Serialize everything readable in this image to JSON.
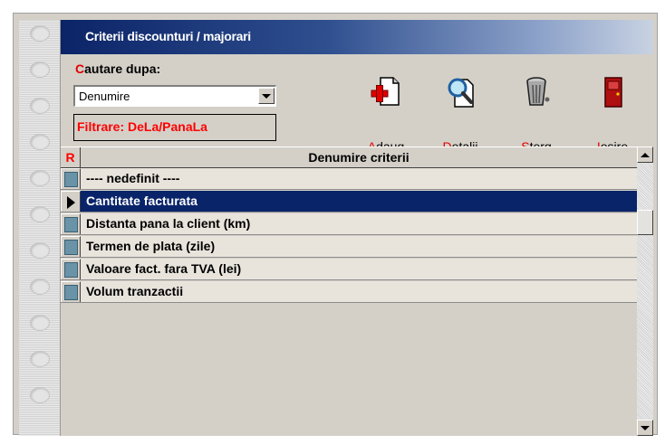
{
  "window": {
    "title": "Criterii discounturi / majorari"
  },
  "search": {
    "label_hotkey": "C",
    "label_rest": "autare dupa:",
    "selected": "Denumire",
    "filter_text": "Filtrare: DeLa/PanaLa"
  },
  "toolbar": [
    {
      "name": "add",
      "hotkey": "A",
      "rest": "daug",
      "icon": "add-document-icon"
    },
    {
      "name": "details",
      "hotkey": "D",
      "rest": "etalii",
      "icon": "magnifier-document-icon"
    },
    {
      "name": "delete",
      "hotkey": "S",
      "rest": "terg",
      "icon": "trash-can-icon"
    },
    {
      "name": "exit",
      "hotkey": "I",
      "rest": "esire",
      "icon": "exit-door-icon"
    }
  ],
  "grid": {
    "indicator_header": "R",
    "column_header": "Denumire criterii",
    "selected_index": 1,
    "rows": [
      "---- nedefinit ----",
      "Cantitate facturata",
      "Distanta pana la client (km)",
      "Termen de plata (zile)",
      "Valoare fact. fara TVA (lei)",
      "Volum tranzactii"
    ]
  },
  "colors": {
    "title_gradient_start": "#0b2467",
    "selection": "#0a246a",
    "hotkey": "#e00000",
    "filter": "#ff0000",
    "face": "#d4d0c8"
  }
}
